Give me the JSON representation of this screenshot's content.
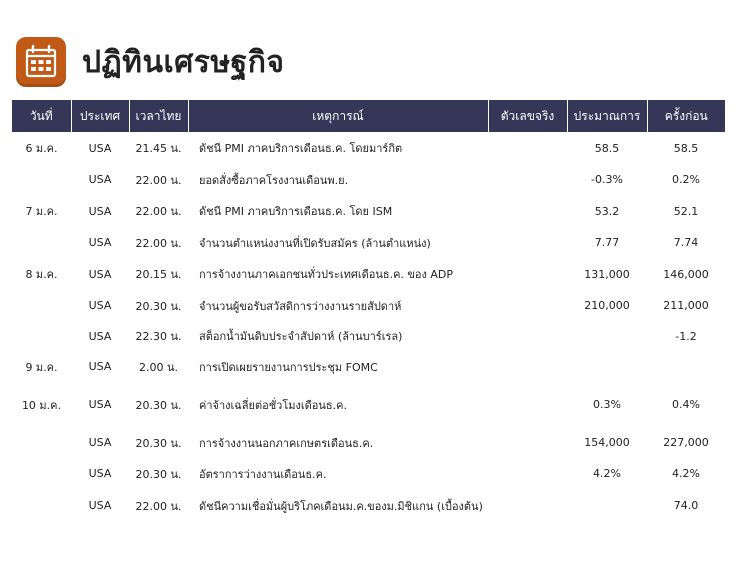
{
  "page": {
    "title": "ปฏิทินเศรษฐกิจ",
    "icon": "calendar-icon",
    "accent_color": "#c25a17",
    "header_color": "#343758"
  },
  "table": {
    "headers": [
      "วันที่",
      "ประเทศ",
      "เวลาไทย",
      "เหตุการณ์",
      "ตัวเลขจริง",
      "ประมาณการ",
      "ครั้งก่อน"
    ],
    "rows": [
      {
        "date": "6 ม.ค.",
        "country": "USA",
        "time": "21.45 น.",
        "event": "ดัชนี PMI ภาคบริการเดือนธ.ค. โดยมาร์กิต",
        "actual": "",
        "forecast": "58.5",
        "previous": "58.5"
      },
      {
        "date": "",
        "country": "USA",
        "time": "22.00 น.",
        "event": "ยอดสั่งซื้อภาคโรงงานเดือนพ.ย.",
        "actual": "",
        "forecast": "-0.3%",
        "previous": "0.2%"
      },
      {
        "date": "7 ม.ค.",
        "country": "USA",
        "time": "22.00 น.",
        "event": "ดัชนี PMI ภาคบริการเดือนธ.ค. โดย ISM",
        "actual": "",
        "forecast": "53.2",
        "previous": "52.1"
      },
      {
        "date": "",
        "country": "USA",
        "time": "22.00 น.",
        "event": "จำนวนตำแหน่งงานที่เปิดรับสมัคร (ล้านตำแหน่ง)",
        "actual": "",
        "forecast": "7.77",
        "previous": "7.74"
      },
      {
        "date": "8 ม.ค.",
        "country": "USA",
        "time": "20.15 น.",
        "event": "การจ้างงานภาคเอกชนทั่วประเทศเดือนธ.ค. ของ ADP",
        "actual": "",
        "forecast": "131,000",
        "previous": "146,000"
      },
      {
        "date": "",
        "country": "USA",
        "time": "20.30 น.",
        "event": "จำนวนผู้ขอรับสวัสดิการว่างงานรายสัปดาห์",
        "actual": "",
        "forecast": "210,000",
        "previous": "211,000"
      },
      {
        "date": "",
        "country": "USA",
        "time": "22.30 น.",
        "event": "สต็อกน้ำมันดิบประจำสัปดาห์ (ล้านบาร์เรล)",
        "actual": "",
        "forecast": "",
        "previous": "-1.2"
      },
      {
        "date": "9 ม.ค.",
        "country": "USA",
        "time": "2.00 น.",
        "event": "การเปิดเผยรายงานการประชุม FOMC",
        "actual": "",
        "forecast": "",
        "previous": ""
      },
      {
        "date": "10 ม.ค.",
        "country": "USA",
        "time": "20.30 น.",
        "event": "ค่าจ้างเฉลี่ยต่อชั่วโมงเดือนธ.ค.",
        "actual": "",
        "forecast": "0.3%",
        "previous": "0.4%"
      },
      {
        "date": "",
        "country": "USA",
        "time": "20.30 น.",
        "event": "การจ้างงานนอกภาคเกษตรเดือนธ.ค.",
        "actual": "",
        "forecast": "154,000",
        "previous": "227,000"
      },
      {
        "date": "",
        "country": "USA",
        "time": "20.30 น.",
        "event": "อัตราการว่างงานเดือนธ.ค.",
        "actual": "",
        "forecast": "4.2%",
        "previous": "4.2%"
      },
      {
        "date": "",
        "country": "USA",
        "time": "22.00 น.",
        "event": "ดัชนีความเชื่อมั่นผู้บริโภคเดือนม.ค.ของม.มิชิแกน (เบื้องต้น)",
        "actual": "",
        "forecast": "",
        "previous": "74.0"
      }
    ]
  }
}
